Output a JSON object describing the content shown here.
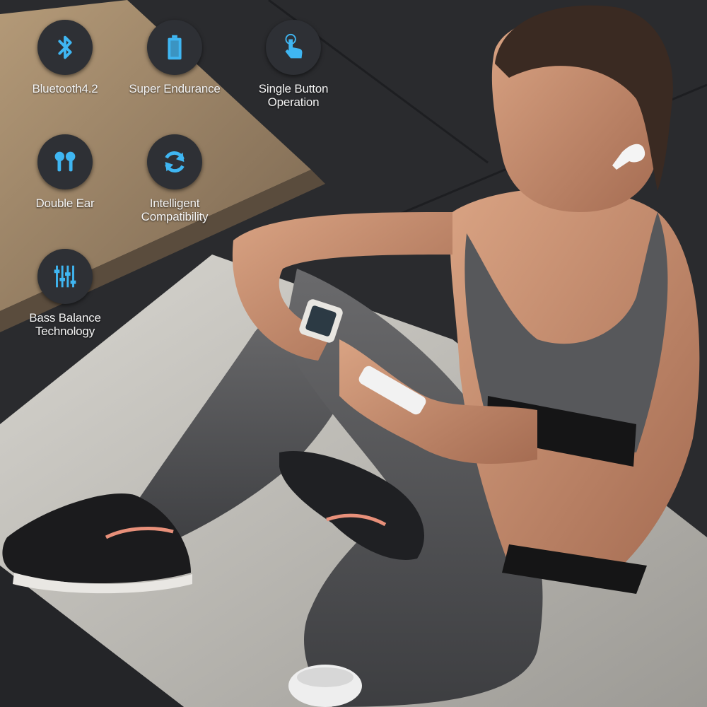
{
  "features": [
    {
      "icon": "bluetooth-icon",
      "lines": [
        "Bluetooth4.2"
      ]
    },
    {
      "icon": "battery-icon",
      "lines": [
        "Super Endurance"
      ]
    },
    {
      "icon": "touch-finger-icon",
      "lines": [
        "Single Button",
        "Operation"
      ]
    },
    {
      "icon": "earbuds-icon",
      "lines": [
        "Double Ear"
      ]
    },
    {
      "icon": "sync-icon",
      "lines": [
        "Intelligent",
        "Compatibility"
      ]
    },
    {
      "icon": "equalizer-icon",
      "lines": [
        "Bass Balance",
        "Technology"
      ]
    }
  ],
  "colors": {
    "icon_accent": "#3fb6f2",
    "badge_bg": "#2e3035",
    "label_text": "#f4f4f4"
  }
}
